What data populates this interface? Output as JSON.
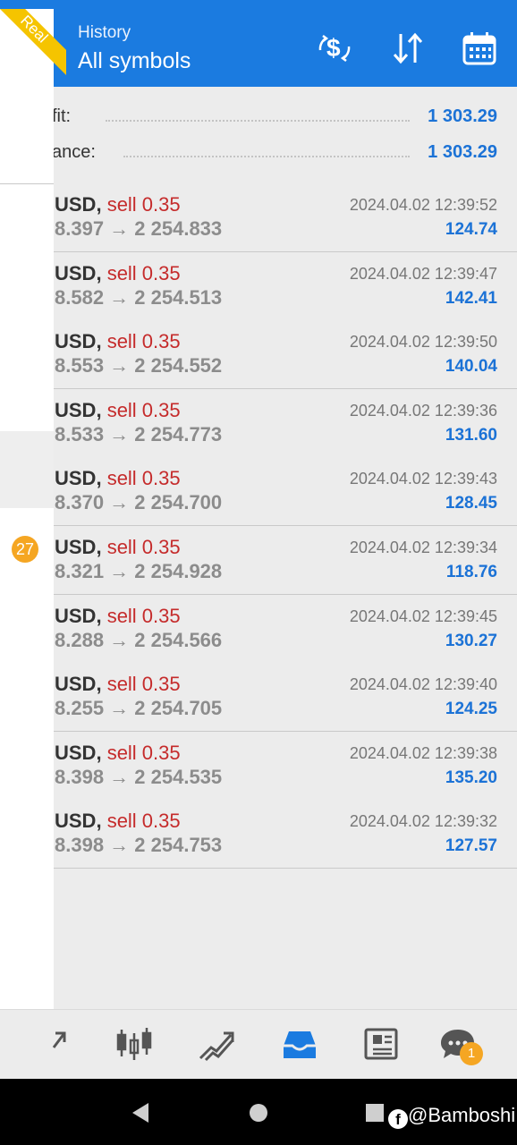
{
  "header": {
    "subtitle": "History",
    "title": "All symbols"
  },
  "badge": "Real",
  "summary": {
    "profit_label": "fit:",
    "profit_value": "1 303.29",
    "balance_label": "ance:",
    "balance_value": "1 303.29"
  },
  "notification_count": "27",
  "trades": [
    {
      "symbol": "USD,",
      "side": "sell 0.35",
      "prices": "8.397 → 2 254.833",
      "time": "2024.04.02 12:39:52",
      "profit": "124.74"
    },
    {
      "symbol": "USD,",
      "side": "sell 0.35",
      "prices": "8.582 → 2 254.513",
      "time": "2024.04.02 12:39:47",
      "profit": "142.41"
    },
    {
      "symbol": "USD,",
      "side": "sell 0.35",
      "prices": "8.553 → 2 254.552",
      "time": "2024.04.02 12:39:50",
      "profit": "140.04"
    },
    {
      "symbol": "USD,",
      "side": "sell 0.35",
      "prices": "8.533 → 2 254.773",
      "time": "2024.04.02 12:39:36",
      "profit": "131.60"
    },
    {
      "symbol": "USD,",
      "side": "sell 0.35",
      "prices": "8.370 → 2 254.700",
      "time": "2024.04.02 12:39:43",
      "profit": "128.45"
    },
    {
      "symbol": "USD,",
      "side": "sell 0.35",
      "prices": "8.321 → 2 254.928",
      "time": "2024.04.02 12:39:34",
      "profit": "118.76"
    },
    {
      "symbol": "USD,",
      "side": "sell 0.35",
      "prices": "8.288 → 2 254.566",
      "time": "2024.04.02 12:39:45",
      "profit": "130.27"
    },
    {
      "symbol": "USD,",
      "side": "sell 0.35",
      "prices": "8.255 → 2 254.705",
      "time": "2024.04.02 12:39:40",
      "profit": "124.25"
    },
    {
      "symbol": "USD,",
      "side": "sell 0.35",
      "prices": "8.398 → 2 254.535",
      "time": "2024.04.02 12:39:38",
      "profit": "135.20"
    },
    {
      "symbol": "USD,",
      "side": "sell 0.35",
      "prices": "8.398 → 2 254.753",
      "time": "2024.04.02 12:39:32",
      "profit": "127.57"
    }
  ],
  "bottom_nav": [
    "quotes-icon",
    "chart-candles-icon",
    "trade-icon",
    "history-icon",
    "news-icon",
    "chat-icon"
  ],
  "chat_badge": "1",
  "watermark": "@Bamboshi",
  "colors": {
    "header": "#1b7be0",
    "profit": "#1b72d6",
    "sell": "#c52b2b",
    "badge": "#f5a623"
  }
}
